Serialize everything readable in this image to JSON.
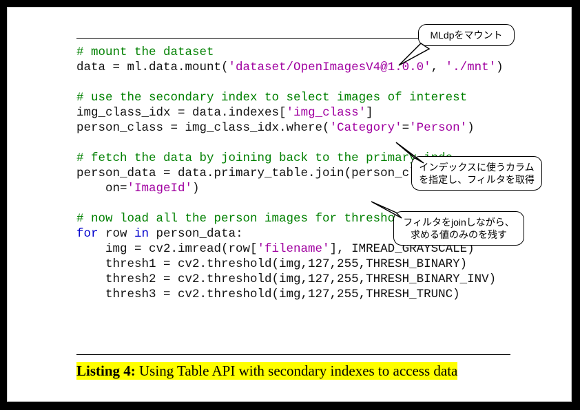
{
  "code": {
    "c1": "# mount the dataset",
    "l2a": "data = ml.data.mount(",
    "l2s1": "'dataset/OpenImagesV4@1.0.0'",
    "l2b": ", ",
    "l2s2": "'./mnt'",
    "l2c": ")",
    "c4": "# use the secondary index to select images of interest",
    "l5a": "img_class_idx = data.indexes[",
    "l5s": "'img_class'",
    "l5b": "]",
    "l6a": "person_class = img_class_idx.where(",
    "l6s1": "'Category'",
    "l6b": "=",
    "l6s2": "'Person'",
    "l6c": ")",
    "c8": "# fetch the data by joining back to the primary inde",
    "l9a": "person_data = data.primary_table.join(person_class,",
    "l10a": "    on=",
    "l10s": "'ImageId'",
    "l10b": ")",
    "c12": "# now load all the person images for threshol",
    "l13kw1": "for",
    "l13a": " row ",
    "l13kw2": "in",
    "l13b": " person_data:",
    "l14a": "    img = cv2.imread(row[",
    "l14s": "'filename'",
    "l14b": "], IMREAD_GRAYSCALE)",
    "l15": "    thresh1 = cv2.threshold(img,127,255,THRESH_BINARY)",
    "l16": "    thresh2 = cv2.threshold(img,127,255,THRESH_BINARY_INV)",
    "l17": "    thresh3 = cv2.threshold(img,127,255,THRESH_TRUNC)"
  },
  "caption": {
    "label": "Listing 4:",
    "text": " Using Table API with secondary indexes to access data"
  },
  "callouts": {
    "b1": "MLdpをマウント",
    "b2": "インデックスに使うカラムを指定し、フィルタを取得",
    "b3": "フィルタをjoinしながら、求める値のみのを残す"
  }
}
